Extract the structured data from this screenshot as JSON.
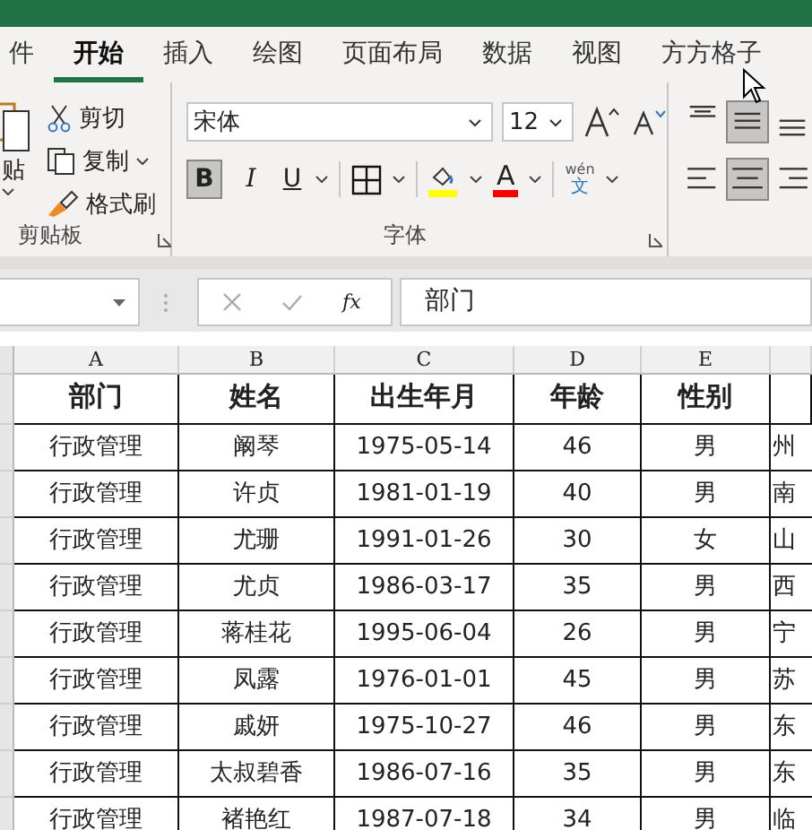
{
  "tabs": [
    {
      "label": "件",
      "selected": false
    },
    {
      "label": "开始",
      "selected": true
    },
    {
      "label": "插入",
      "selected": false
    },
    {
      "label": "绘图",
      "selected": false
    },
    {
      "label": "页面布局",
      "selected": false
    },
    {
      "label": "数据",
      "selected": false
    },
    {
      "label": "视图",
      "selected": false
    },
    {
      "label": "方方格子",
      "selected": false
    }
  ],
  "clipboard": {
    "paste_label": "贴",
    "commands": [
      {
        "label": "剪切",
        "kind": "cut"
      },
      {
        "label": "复制",
        "kind": "copy"
      },
      {
        "label": "格式刷",
        "kind": "painter"
      }
    ],
    "group_label": "剪贴板"
  },
  "font": {
    "family": "宋体",
    "size": "12",
    "bold_label": "B",
    "bold": true,
    "italic_label": "I",
    "underline_label": "U",
    "font_color_label": "A",
    "phonetic_top": "wén",
    "phonetic_bottom": "文",
    "group_label": "字体"
  },
  "alignment": {
    "buttons": [
      {
        "kind": "top",
        "selected": false
      },
      {
        "kind": "middle",
        "selected": true
      },
      {
        "kind": "bottom",
        "selected": false
      },
      {
        "kind": "left",
        "selected": false
      },
      {
        "kind": "center",
        "selected": true
      },
      {
        "kind": "right",
        "selected": false
      }
    ]
  },
  "formula_bar": {
    "function_label": "fx",
    "content": "部门"
  },
  "sheet": {
    "columns": [
      "A",
      "B",
      "C",
      "D",
      "E"
    ],
    "header": [
      "部门",
      "姓名",
      "出生年月",
      "年龄",
      "性别"
    ],
    "rows": [
      [
        "行政管理",
        "阚琴",
        "1975-05-14",
        "46",
        "男",
        "州"
      ],
      [
        "行政管理",
        "许贞",
        "1981-01-19",
        "40",
        "男",
        "南"
      ],
      [
        "行政管理",
        "尤珊",
        "1991-01-26",
        "30",
        "女",
        "山"
      ],
      [
        "行政管理",
        "尤贞",
        "1986-03-17",
        "35",
        "男",
        "西"
      ],
      [
        "行政管理",
        "蒋桂花",
        "1995-06-04",
        "26",
        "男",
        "宁"
      ],
      [
        "行政管理",
        "凤露",
        "1976-01-01",
        "45",
        "男",
        "苏"
      ],
      [
        "行政管理",
        "戚妍",
        "1975-10-27",
        "46",
        "男",
        "东"
      ],
      [
        "行政管理",
        "太叔碧香",
        "1986-07-16",
        "35",
        "男",
        "东"
      ],
      [
        "行政管理",
        "褚艳红",
        "1987-07-18",
        "34",
        "男",
        "临"
      ]
    ]
  }
}
